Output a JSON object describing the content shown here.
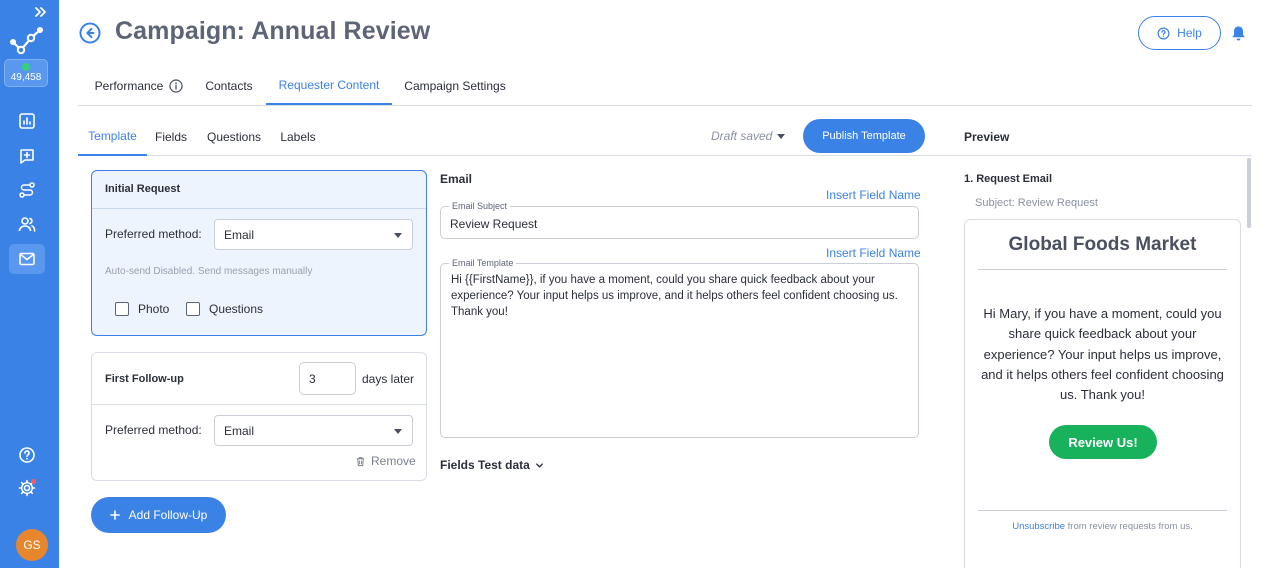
{
  "sidebar": {
    "points": "49,458",
    "avatar_initials": "GS",
    "nav_icons": [
      "analytics-icon",
      "add-box-icon",
      "route-icon",
      "people-icon",
      "mail-icon"
    ],
    "bottom_icons": [
      "help-circle-icon",
      "settings-icon"
    ],
    "accent": "#3b82e6"
  },
  "header": {
    "title": "Campaign: Annual Review",
    "help_label": "Help"
  },
  "main_tabs": [
    {
      "label": "Performance"
    },
    {
      "label": "Contacts"
    },
    {
      "label": "Requester Content",
      "active": true
    },
    {
      "label": "Campaign Settings"
    }
  ],
  "sub_tabs": [
    {
      "label": "Template",
      "active": true
    },
    {
      "label": "Fields"
    },
    {
      "label": "Questions"
    },
    {
      "label": "Labels"
    }
  ],
  "toolbar": {
    "draft_status": "Draft saved",
    "publish_label": "Publish Template"
  },
  "initial_request": {
    "title": "Initial Request",
    "method_label": "Preferred method:",
    "method_value": "Email",
    "note": "Auto-send Disabled. Send messages manually",
    "photo_label": "Photo",
    "questions_label": "Questions"
  },
  "follow_up": {
    "title": "First Follow-up",
    "days_value": "3",
    "days_suffix": "days later",
    "method_label": "Preferred method:",
    "method_value": "Email",
    "remove_label": "Remove"
  },
  "add_followup_label": "Add Follow-Up",
  "email": {
    "heading": "Email",
    "insert_field_label": "Insert Field Name",
    "subject_label": "Email Subject",
    "subject_value": "Review Request",
    "template_label": "Email Template",
    "template_value": "Hi {{FirstName}}, if you have a moment, could you share quick feedback about your experience? Your input helps us improve, and it helps others feel confident choosing us. Thank you!",
    "fields_test_label": "Fields Test data"
  },
  "preview": {
    "title": "Preview",
    "step": "1. Request Email",
    "subject": "Subject: Review Request",
    "brand": "Global Foods Market",
    "body": "Hi Mary, if you have a moment, could you share quick feedback about your experience? Your input helps us improve, and it helps others feel confident choosing us. Thank you!",
    "cta": "Review Us!",
    "unsubscribe_link": "Unsubscribe",
    "unsubscribe_suffix": " from review requests from us.",
    "cta_color": "#19b25c"
  }
}
